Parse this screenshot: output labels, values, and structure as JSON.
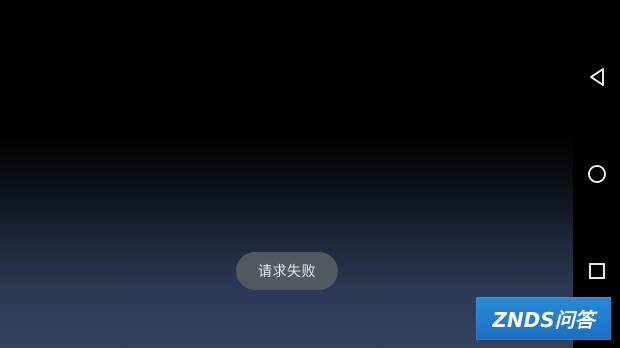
{
  "toast": {
    "message": "请求失败"
  },
  "navigation_bar": {
    "back_icon": "back-triangle-icon",
    "home_icon": "home-circle-icon",
    "recent_icon": "recent-apps-square-icon"
  },
  "watermark": {
    "text": "ZNDS问答"
  },
  "colors": {
    "nav_icon": "#ffffff",
    "toast_background": "#585c62",
    "watermark_background": "#2a8ad8"
  }
}
